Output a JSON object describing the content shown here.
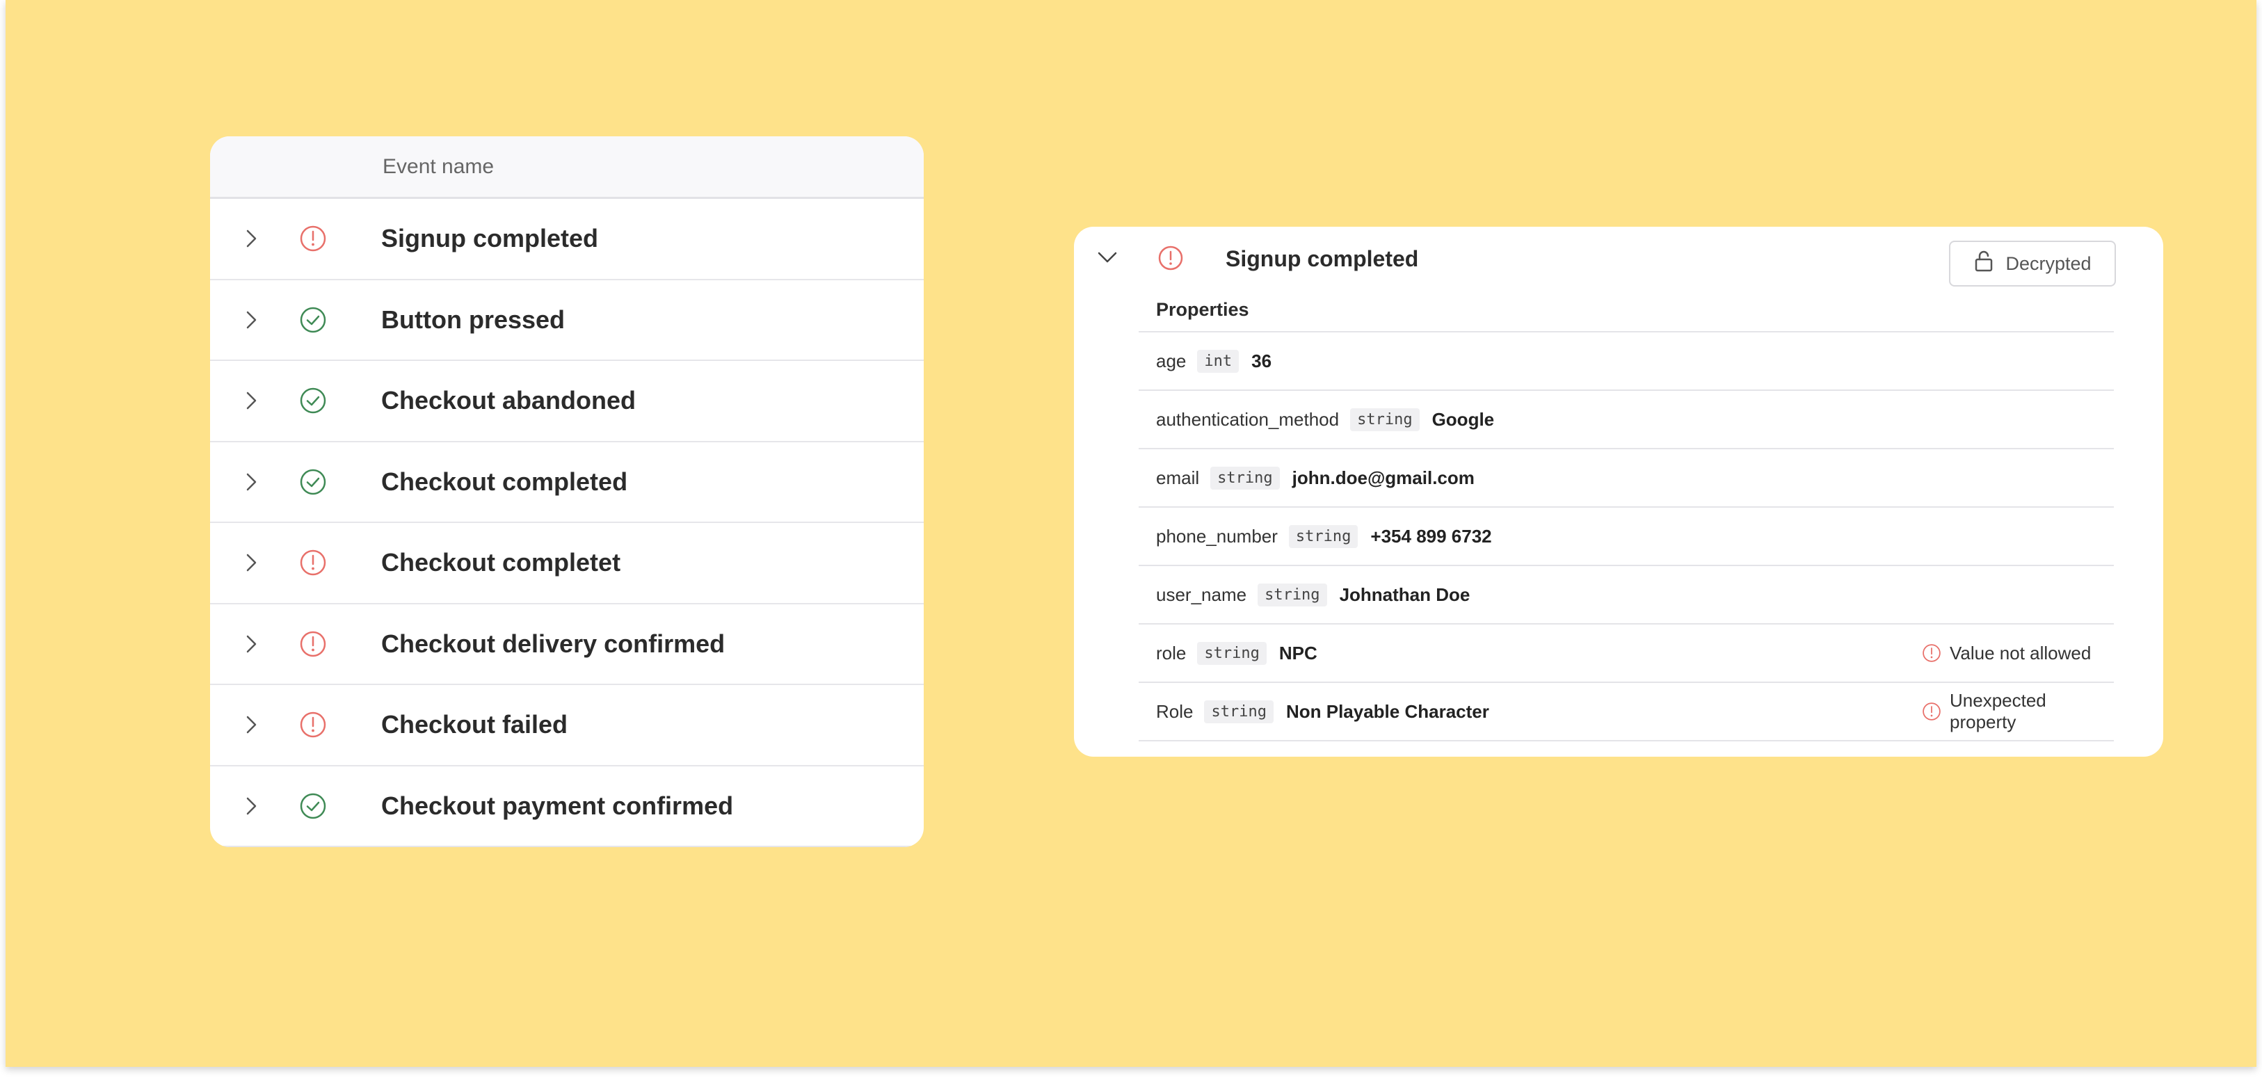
{
  "colors": {
    "background": "#fee28a",
    "error": "#e8706a",
    "success": "#3f8a55"
  },
  "events_table": {
    "column_header": "Event name",
    "rows": [
      {
        "name": "Signup completed",
        "status": "error",
        "icon": "alert-circle-icon"
      },
      {
        "name": "Button pressed",
        "status": "success",
        "icon": "check-circle-icon"
      },
      {
        "name": "Checkout abandoned",
        "status": "success",
        "icon": "check-circle-icon"
      },
      {
        "name": "Checkout completed",
        "status": "success",
        "icon": "check-circle-icon"
      },
      {
        "name": "Checkout completet",
        "status": "error",
        "icon": "alert-circle-icon"
      },
      {
        "name": "Checkout delivery confirmed",
        "status": "error",
        "icon": "alert-circle-icon"
      },
      {
        "name": "Checkout failed",
        "status": "error",
        "icon": "alert-circle-icon"
      },
      {
        "name": "Checkout payment confirmed",
        "status": "success",
        "icon": "check-circle-icon"
      }
    ]
  },
  "event_detail": {
    "title": "Signup completed",
    "status": "error",
    "decrypted_label": "Decrypted",
    "properties_title": "Properties",
    "properties": [
      {
        "key": "age",
        "type": "int",
        "value": "36",
        "warning": ""
      },
      {
        "key": "authentication_method",
        "type": "string",
        "value": "Google",
        "warning": ""
      },
      {
        "key": "email",
        "type": "string",
        "value": "john.doe@gmail.com",
        "warning": ""
      },
      {
        "key": "phone_number",
        "type": "string",
        "value": "+354 899 6732",
        "warning": ""
      },
      {
        "key": "user_name",
        "type": "string",
        "value": "Johnathan Doe",
        "warning": ""
      },
      {
        "key": "role",
        "type": "string",
        "value": "NPC",
        "warning": "Value not allowed"
      },
      {
        "key": "Role",
        "type": "string",
        "value": "Non Playable Character",
        "warning": "Unexpected property"
      }
    ]
  }
}
